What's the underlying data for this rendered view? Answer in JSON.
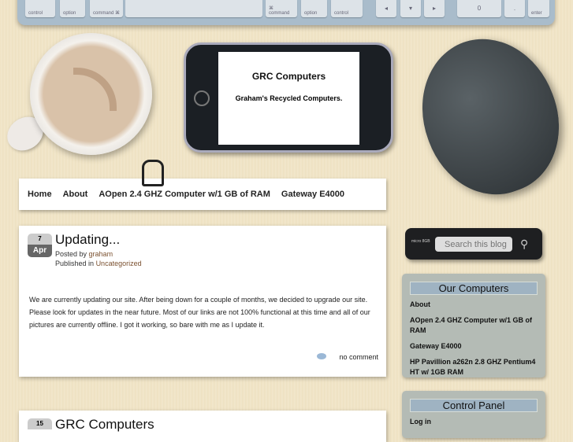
{
  "keyboard": {
    "keys": [
      "control",
      "option",
      "command ⌘",
      "",
      "⌘ command",
      "option",
      "control",
      "◂",
      "▾",
      "▸",
      "0",
      ".",
      "enter"
    ]
  },
  "header": {
    "site_title": "GRC Computers",
    "tagline": "Graham's Recycled Computers."
  },
  "nav": {
    "items": [
      "Home",
      "About",
      "AOpen 2.4 GHZ Computer w/1 GB of RAM",
      "Gateway E4000"
    ]
  },
  "posts": [
    {
      "day": "7",
      "month": "Apr",
      "title": "Updating...",
      "posted_by_label": "Posted by",
      "author": "graham",
      "published_label": "Published in",
      "category": "Uncategorized",
      "body": "We are currently updating our site.  After being down for a couple of months, we decided to upgrade our site.  Please look for updates in the near future.  Most of our links are not 100% functional at this time and all of our pictures are currently offline.  I got it working, so bare with me as I update it.",
      "comments": "no comment"
    },
    {
      "day": "15",
      "title": "GRC Computers"
    }
  ],
  "search": {
    "label": "micro 8GB",
    "placeholder": "Search this blog"
  },
  "sidebar": {
    "our_computers": {
      "title": "Our Computers",
      "items": [
        "About",
        "AOpen 2.4 GHZ Computer w/1 GB of RAM",
        "Gateway E4000",
        "HP Pavillion a262n 2.8 GHZ Pentium4 HT w/ 1GB RAM"
      ]
    },
    "control_panel": {
      "title": "Control Panel",
      "items": [
        "Log in"
      ]
    }
  }
}
